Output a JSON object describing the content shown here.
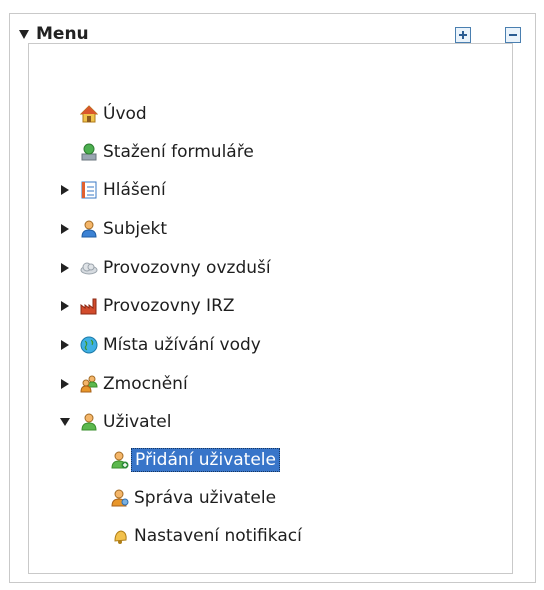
{
  "menu": {
    "title": "Menu",
    "expand_all_label": "+",
    "collapse_all_label": "−"
  },
  "tree": {
    "items": [
      {
        "label": "Úvod",
        "icon": "home-icon"
      },
      {
        "label": "Stažení formuláře",
        "icon": "download-icon"
      },
      {
        "label": "Hlášení",
        "icon": "report-icon",
        "state": "collapsed"
      },
      {
        "label": "Subjekt",
        "icon": "person-icon",
        "state": "collapsed"
      },
      {
        "label": "Provozovny ovzduší",
        "icon": "cloud-icon",
        "state": "collapsed"
      },
      {
        "label": "Provozovny IRZ",
        "icon": "factory-icon",
        "state": "collapsed"
      },
      {
        "label": "Místa užívání vody",
        "icon": "globe-icon",
        "state": "collapsed"
      },
      {
        "label": "Zmocnění",
        "icon": "users-icon",
        "state": "collapsed"
      },
      {
        "label": "Uživatel",
        "icon": "user-icon",
        "state": "expanded"
      },
      {
        "label": "Přidání uživatele",
        "icon": "user-add-icon",
        "selected": true
      },
      {
        "label": "Správa uživatele",
        "icon": "user-manage-icon"
      },
      {
        "label": "Nastavení notifikací",
        "icon": "bell-icon"
      }
    ]
  },
  "colors": {
    "selection_bg": "#3875c9",
    "border": "#c9c9c9"
  }
}
